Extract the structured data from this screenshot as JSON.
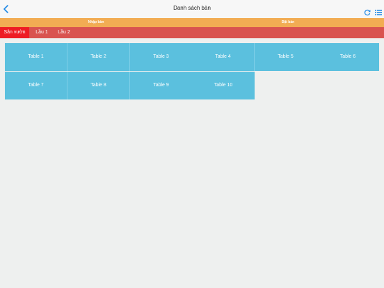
{
  "header": {
    "title": "Danh sách bàn",
    "back_icon": "chevron-left-icon",
    "refresh_icon": "refresh-icon",
    "list_icon": "list-icon",
    "accent_color": "#1e88e5"
  },
  "order_tabs": [
    {
      "label": "Nhập bàn"
    },
    {
      "label": "Đặt bàn"
    }
  ],
  "areas": [
    {
      "label": "Sân vườn",
      "active": true
    },
    {
      "label": "Lầu 1",
      "active": false
    },
    {
      "label": "Lầu 2",
      "active": false
    }
  ],
  "tables": [
    {
      "label": "Table 1"
    },
    {
      "label": "Table 2"
    },
    {
      "label": "Table 3"
    },
    {
      "label": "Table 4"
    },
    {
      "label": "Table 5"
    },
    {
      "label": "Table 6"
    },
    {
      "label": "Table 7"
    },
    {
      "label": "Table 8"
    },
    {
      "label": "Table 9"
    },
    {
      "label": "Table 10"
    }
  ],
  "colors": {
    "order_bar": "#f2ac53",
    "area_bar": "#d9534f",
    "area_active": "#ee1c24",
    "table_bg": "#5bc0de",
    "page_bg": "#eef0ef"
  }
}
